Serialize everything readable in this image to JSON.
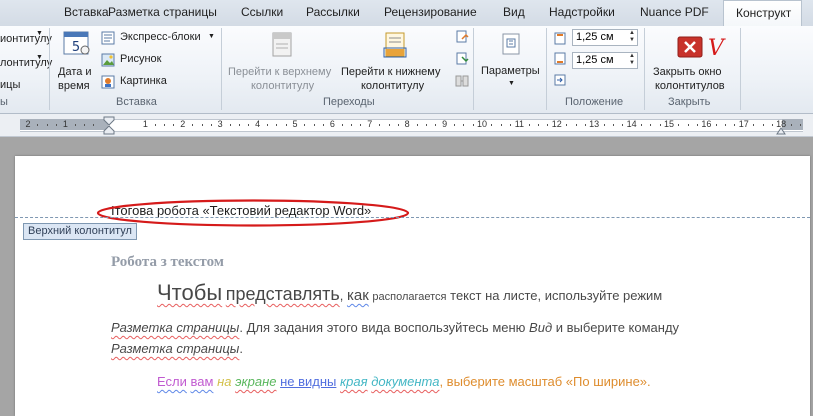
{
  "tabs": [
    "Вставка",
    "Разметка страницы",
    "Ссылки",
    "Рассылки",
    "Рецензирование",
    "Вид",
    "Надстройки",
    "Nuance PDF",
    "Конструкт"
  ],
  "ribbon": {
    "left_cut": [
      "ионтитулу",
      "лонтитулу",
      "ицы"
    ],
    "left_group_cut": "ы",
    "insert": {
      "date_time": [
        "Дата и",
        "время"
      ],
      "express_blocks": "Экспресс-блоки",
      "picture": "Рисунок",
      "clipart": "Картинка",
      "group_label": "Вставка"
    },
    "navigation": {
      "goto_header": [
        "Перейти к верхнему",
        "колонтитулу"
      ],
      "goto_footer": [
        "Перейти к нижнему",
        "колонтитулу"
      ],
      "group_label": "Переходы"
    },
    "options": {
      "label": "Параметры"
    },
    "position": {
      "header_value": "1,25 см",
      "footer_value": "1,25 см",
      "group_label": "Положение"
    },
    "close": {
      "label": [
        "Закрыть окно",
        "колонтитулов"
      ],
      "mark": "V",
      "group_label": "Закрыть"
    }
  },
  "ruler": {
    "numbers": [
      "2",
      "1",
      "1",
      "2",
      "3",
      "4",
      "5",
      "6",
      "7",
      "8",
      "9",
      "10",
      "11",
      "12",
      "13",
      "14",
      "15",
      "16",
      "17",
      "18"
    ]
  },
  "document": {
    "header_text": "Ітогова робота «Текстовий редактор Word»",
    "header_tag": "Верхний колонтитул",
    "heading": "Робота з текстом",
    "line1": {
      "w1": "Чтобы",
      "w2": "представлять",
      "w3": ",",
      "w4": "как",
      "w5": "располагается",
      "w6": "текст на листе, используйте режим"
    },
    "line2": {
      "w1": "Разметка страницы",
      "w2": ". Для задания этого вида  воспользуйтесь меню",
      "w3": "Вид",
      "w4": "и выберите команду"
    },
    "line3": {
      "w1": "Разметка страницы",
      "w2": "."
    },
    "line4": {
      "w1": "Если",
      "w2": "вам",
      "w3": "на",
      "w4": "экране",
      "w5": "не видны",
      "w6": "края",
      "w7": "документа",
      "w8": ", выберите масштаб «По ширине»."
    }
  },
  "colors": {
    "annotation_red": "#d51a1a",
    "color_word_purple": "#b336c6",
    "color_word_yellow": "#c9b322",
    "color_word_green": "#36a83a",
    "color_word_blue": "#2c4fd8",
    "color_word_teal": "#1aa7b8",
    "color_word_orange": "#d77400",
    "heading_grey": "#7d8796"
  }
}
